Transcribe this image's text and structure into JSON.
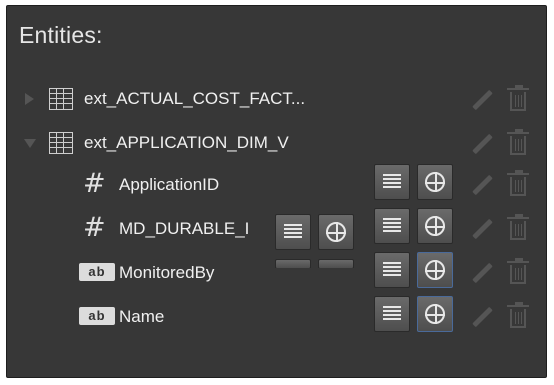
{
  "panel": {
    "title": "Entities:"
  },
  "entities": [
    {
      "label": "ext_ACTUAL_COST_FACT...",
      "expanded": false
    },
    {
      "label": "ext_APPLICATION_DIM_V",
      "expanded": true
    }
  ],
  "attributes": [
    {
      "label": "ApplicationID",
      "type_icon": "number-hash-icon"
    },
    {
      "label": "MD_DURABLE_I",
      "type_icon": "number-hash-icon"
    },
    {
      "label": "MonitoredBy",
      "type_icon": "text-ab-icon",
      "badge": "ab"
    },
    {
      "label": "Name",
      "type_icon": "text-ab-icon",
      "badge": "ab"
    }
  ],
  "icons": {
    "hash_glyph": "#",
    "expand_collapsed": "triangle-right-icon",
    "expand_open": "triangle-down-icon",
    "edit": "pencil-icon",
    "delete": "trash-icon",
    "measure": "list-lines-icon",
    "dimension": "crosshair-circle-icon"
  },
  "colors": {
    "panel_bg": "#373737",
    "text": "#f0f0f0",
    "selected_border": "#4a6a9a"
  }
}
